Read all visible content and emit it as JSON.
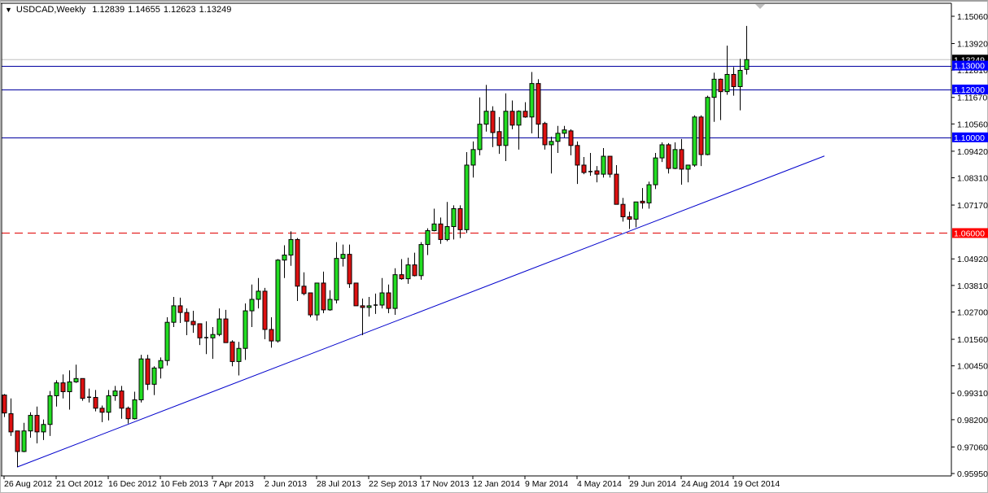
{
  "header": {
    "menu_icon": "triangle-down-icon",
    "symbol_timeframe": "USDCAD,Weekly",
    "open": "1.12839",
    "high": "1.14655",
    "low": "1.12623",
    "close": "1.13249"
  },
  "colors": {
    "bull": "#22dd22",
    "bear": "#dd1111",
    "candle_border": "#000000",
    "resistance_line": "#0000a0",
    "support_dashed": "#e00000",
    "trendline": "#0000cc",
    "price_line": "#c0c0c0"
  },
  "chart_data": {
    "type": "candlestick",
    "title": "USDCAD,Weekly",
    "ylim": [
      0.9557,
      1.1574
    ],
    "y_ticks": [
      "1.15060",
      "1.13920",
      "1.12810",
      "1.11670",
      "1.10560",
      "1.09420",
      "1.08310",
      "1.07170",
      "1.04920",
      "1.03810",
      "1.02700",
      "1.01560",
      "1.00450",
      "0.99310",
      "0.98200",
      "0.97060",
      "0.95950"
    ],
    "x_tick_labels": [
      "26 Aug 2012",
      "21 Oct 2012",
      "16 Dec 2012",
      "10 Feb 2013",
      "7 Apr 2013",
      "2 Jun 2013",
      "28 Jul 2013",
      "22 Sep 2013",
      "17 Nov 2013",
      "12 Jan 2014",
      "9 Mar 2014",
      "4 May 2014",
      "29 Jun 2014",
      "24 Aug 2014",
      "19 Oct 2014"
    ],
    "weeks_per_x_tick": 8,
    "horizontal_levels": [
      {
        "price": 1.13,
        "label": "1.13000",
        "style": "solid",
        "color": "#0000a0",
        "label_bg": "#0000ff"
      },
      {
        "price": 1.12,
        "label": "1.12000",
        "style": "solid",
        "color": "#0000a0",
        "label_bg": "#0000ff"
      },
      {
        "price": 1.1,
        "label": "1.10000",
        "style": "solid",
        "color": "#0000a0",
        "label_bg": "#0000ff"
      },
      {
        "price": 1.06,
        "label": "1.06000",
        "style": "dashed",
        "color": "#e00000",
        "label_bg": "#ff0000"
      }
    ],
    "current_price": {
      "price": 1.13249,
      "label": "1.13249"
    },
    "trendline": {
      "from_week": 2,
      "from_price": 0.9622,
      "to_week": 126,
      "to_price": 1.0922
    },
    "ohlc_columns": [
      "open",
      "high",
      "low",
      "close"
    ],
    "candles": [
      [
        0.9923,
        0.9927,
        0.9831,
        0.9848
      ],
      [
        0.9845,
        0.9909,
        0.9752,
        0.9769
      ],
      [
        0.9773,
        0.9773,
        0.9622,
        0.9687
      ],
      [
        0.9687,
        0.9807,
        0.9684,
        0.9773
      ],
      [
        0.9773,
        0.9851,
        0.9745,
        0.9838
      ],
      [
        0.9838,
        0.9875,
        0.9721,
        0.9769
      ],
      [
        0.9769,
        0.9821,
        0.9735,
        0.98
      ],
      [
        0.98,
        0.994,
        0.9752,
        0.992
      ],
      [
        0.992,
        0.9985,
        0.9875,
        0.9974
      ],
      [
        0.9974,
        1.0009,
        0.9909,
        0.9937
      ],
      [
        0.9937,
        1.0026,
        0.9862,
        0.9978
      ],
      [
        0.9978,
        1.005,
        0.9974,
        0.9992
      ],
      [
        0.9992,
        0.9992,
        0.9899,
        0.9909
      ],
      [
        0.9913,
        0.995,
        0.9892,
        0.9914
      ],
      [
        0.9913,
        0.9944,
        0.9855,
        0.9868
      ],
      [
        0.9868,
        0.9879,
        0.981,
        0.9851
      ],
      [
        0.9851,
        0.9944,
        0.9817,
        0.992
      ],
      [
        0.992,
        0.9961,
        0.9899,
        0.994
      ],
      [
        0.994,
        0.9961,
        0.9824,
        0.9868
      ],
      [
        0.9868,
        0.9875,
        0.9804,
        0.9824
      ],
      [
        0.9824,
        0.9937,
        0.9821,
        0.9903
      ],
      [
        0.9903,
        1.0091,
        0.9892,
        1.0074
      ],
      [
        1.0074,
        1.0091,
        0.9944,
        0.9968
      ],
      [
        0.9968,
        1.0043,
        0.9923,
        1.0036
      ],
      [
        1.0036,
        1.008,
        0.9992,
        1.0067
      ],
      [
        1.0067,
        1.0248,
        1.0046,
        1.0227
      ],
      [
        1.0227,
        1.0333,
        1.0207,
        1.0296
      ],
      [
        1.0296,
        1.033,
        1.0224,
        1.0268
      ],
      [
        1.0268,
        1.0285,
        1.0173,
        1.0231
      ],
      [
        1.0231,
        1.0275,
        1.0183,
        1.0217
      ],
      [
        1.0221,
        1.0221,
        1.0132,
        1.0162
      ],
      [
        1.0162,
        1.0231,
        1.0094,
        1.0163
      ],
      [
        1.0162,
        1.0207,
        1.0074,
        1.0176
      ],
      [
        1.0176,
        1.0285,
        1.0169,
        1.0241
      ],
      [
        1.0241,
        1.0279,
        1.0142,
        1.0142
      ],
      [
        1.0145,
        1.0152,
        1.0043,
        1.0063
      ],
      [
        1.0063,
        1.0145,
        1.0005,
        1.0118
      ],
      [
        1.0118,
        1.0306,
        1.007,
        1.0275
      ],
      [
        1.0275,
        1.0385,
        1.0207,
        1.0323
      ],
      [
        1.0323,
        1.0412,
        1.0285,
        1.0357
      ],
      [
        1.0357,
        1.0371,
        1.0156,
        1.0197
      ],
      [
        1.0197,
        1.0248,
        1.0121,
        1.0149
      ],
      [
        1.0149,
        1.0491,
        1.0142,
        1.0487
      ],
      [
        1.0487,
        1.0549,
        1.0412,
        1.0508
      ],
      [
        1.0508,
        1.0607,
        1.0463,
        1.0573
      ],
      [
        1.0573,
        1.0579,
        1.0316,
        1.0378
      ],
      [
        1.0378,
        1.0436,
        1.034,
        1.0347
      ],
      [
        1.035,
        1.035,
        1.0248,
        1.0258
      ],
      [
        1.0258,
        1.0391,
        1.0234,
        1.0391
      ],
      [
        1.0391,
        1.0439,
        1.0265,
        1.0279
      ],
      [
        1.0279,
        1.0361,
        1.0275,
        1.0323
      ],
      [
        1.032,
        1.0562,
        1.0306,
        1.0494
      ],
      [
        1.0494,
        1.0552,
        1.046,
        1.0511
      ],
      [
        1.0511,
        1.0552,
        1.0371,
        1.0388
      ],
      [
        1.0391,
        1.0391,
        1.0296,
        1.0296
      ],
      [
        1.0296,
        1.0326,
        1.0173,
        1.0289
      ],
      [
        1.0289,
        1.0333,
        1.0251,
        1.0296
      ],
      [
        1.0296,
        1.0347,
        1.0262,
        1.0299
      ],
      [
        1.0299,
        1.0412,
        1.0285,
        1.035
      ],
      [
        1.035,
        1.0385,
        1.0265,
        1.0285
      ],
      [
        1.0285,
        1.0453,
        1.0258,
        1.0426
      ],
      [
        1.0426,
        1.0491,
        1.0405,
        1.0409
      ],
      [
        1.0409,
        1.0497,
        1.0388,
        1.0467
      ],
      [
        1.0467,
        1.0518,
        1.0419,
        1.0422
      ],
      [
        1.0422,
        1.0562,
        1.0405,
        1.0552
      ],
      [
        1.0552,
        1.062,
        1.0508,
        1.061
      ],
      [
        1.061,
        1.0702,
        1.0607,
        1.0638
      ],
      [
        1.0638,
        1.0665,
        1.0555,
        1.0573
      ],
      [
        1.0573,
        1.073,
        1.0566,
        1.0627
      ],
      [
        1.0627,
        1.0716,
        1.0573,
        1.0702
      ],
      [
        1.0702,
        1.0716,
        1.0579,
        1.0614
      ],
      [
        1.0614,
        1.0938,
        1.06,
        1.0884
      ],
      [
        1.0884,
        1.0983,
        1.0832,
        1.0949
      ],
      [
        1.0949,
        1.1167,
        1.0925,
        1.1055
      ],
      [
        1.1055,
        1.1219,
        1.1024,
        1.1109
      ],
      [
        1.1109,
        1.113,
        1.0959,
        1.102
      ],
      [
        1.1024,
        1.1085,
        1.0931,
        1.0966
      ],
      [
        1.0966,
        1.1184,
        1.0901,
        1.1109
      ],
      [
        1.1109,
        1.1154,
        1.1034,
        1.1051
      ],
      [
        1.1051,
        1.1113,
        1.0949,
        1.1109
      ],
      [
        1.1109,
        1.1147,
        1.1082,
        1.1085
      ],
      [
        1.1085,
        1.1273,
        1.1017,
        1.1225
      ],
      [
        1.1225,
        1.1243,
        1.0996,
        1.1055
      ],
      [
        1.1058,
        1.1065,
        1.0949,
        1.0969
      ],
      [
        1.0969,
        1.1003,
        1.0849,
        1.0983
      ],
      [
        1.0983,
        1.1048,
        1.0935,
        1.1017
      ],
      [
        1.1017,
        1.1048,
        1.1,
        1.1031
      ],
      [
        1.1027,
        1.1034,
        1.0925,
        1.0966
      ],
      [
        1.0966,
        1.0983,
        1.0805,
        1.0884
      ],
      [
        1.0884,
        1.0918,
        1.0846,
        1.0853
      ],
      [
        1.0856,
        1.0935,
        1.0839,
        1.0857
      ],
      [
        1.086,
        1.088,
        1.0812,
        1.0846
      ],
      [
        1.0846,
        1.0955,
        1.0832,
        1.0921
      ],
      [
        1.0921,
        1.0921,
        1.0832,
        1.0846
      ],
      [
        1.0846,
        1.0884,
        1.072,
        1.072
      ],
      [
        1.072,
        1.0747,
        1.0648,
        1.0668
      ],
      [
        1.0668,
        1.0689,
        1.0617,
        1.0658
      ],
      [
        1.0658,
        1.073,
        1.0624,
        1.073
      ],
      [
        1.0733,
        1.0788,
        1.0702,
        1.0726
      ],
      [
        1.0726,
        1.0815,
        1.0702,
        1.0802
      ],
      [
        1.0802,
        1.0935,
        1.0784,
        1.0914
      ],
      [
        1.0914,
        1.0979,
        1.0897,
        1.0969
      ],
      [
        1.0969,
        1.0976,
        1.0849,
        1.087
      ],
      [
        1.087,
        1.0979,
        1.0867,
        1.0949
      ],
      [
        1.0949,
        1.0993,
        1.0802,
        1.0867
      ],
      [
        1.0867,
        1.0884,
        1.0812,
        1.0884
      ],
      [
        1.0884,
        1.1092,
        1.0877,
        1.1085
      ],
      [
        1.1085,
        1.1092,
        1.088,
        1.0928
      ],
      [
        1.0928,
        1.1174,
        1.0925,
        1.1167
      ],
      [
        1.1167,
        1.127,
        1.1065,
        1.1243
      ],
      [
        1.1243,
        1.1246,
        1.1072,
        1.1191
      ],
      [
        1.1191,
        1.1383,
        1.1178,
        1.1263
      ],
      [
        1.1263,
        1.1294,
        1.1174,
        1.1212
      ],
      [
        1.1212,
        1.1328,
        1.1113,
        1.128
      ],
      [
        1.12839,
        1.14655,
        1.12623,
        1.13249
      ]
    ]
  }
}
